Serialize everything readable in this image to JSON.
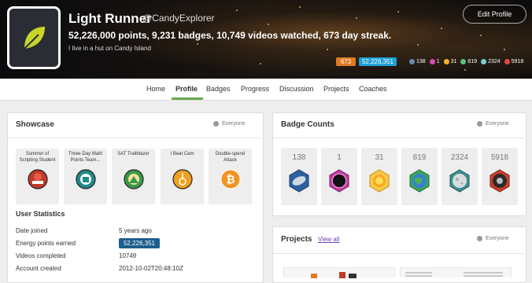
{
  "profile": {
    "name": "Light Runner",
    "handle": "@CandyExplorer",
    "stats_line": "52,226,000 points, 9,231 badges, 10,749 videos watched, 673 day streak.",
    "bio": "I live in a hut on Candy Island",
    "edit_label": "Edit Profile",
    "streak_pill": "673",
    "points_pill": "52,226,351",
    "header_badge_counts": [
      {
        "icon": "meteorite-badge-icon",
        "color": "#6a88b5",
        "value": "138"
      },
      {
        "icon": "moon-badge-icon",
        "color": "#d84bb0",
        "value": "1"
      },
      {
        "icon": "earth-badge-icon",
        "color": "#f0b41e",
        "value": "31"
      },
      {
        "icon": "sun-badge-icon",
        "color": "#5cc07a",
        "value": "819"
      },
      {
        "icon": "black-hole-badge-icon",
        "color": "#7ad0d8",
        "value": "2324"
      },
      {
        "icon": "challenge-patch-icon",
        "color": "#e04a3a",
        "value": "5918"
      }
    ]
  },
  "nav": {
    "items": [
      "Home",
      "Profile",
      "Badges",
      "Progress",
      "Discussion",
      "Projects",
      "Coaches"
    ],
    "active": "Profile"
  },
  "showcase": {
    "title": "Showcase",
    "visibility": "Everyone",
    "badges": [
      {
        "label": "Summer of Scripting Student",
        "icon": "student-patch-icon",
        "color": "#c0392b"
      },
      {
        "label": "Three-Day Math Points Team...",
        "icon": "team-patch-icon",
        "color": "#1f8a8a"
      },
      {
        "label": "SAT Trailblazer",
        "icon": "trailblazer-patch-icon",
        "color": "#3a9a48"
      },
      {
        "label": "I Beat Cam",
        "icon": "unicycle-patch-icon",
        "color": "#f0a020"
      },
      {
        "label": "Double-spend Attack",
        "icon": "bitcoin-patch-icon",
        "color": "#f09422"
      }
    ]
  },
  "user_statistics": {
    "title": "User Statistics",
    "rows": [
      {
        "label": "Date joined",
        "value": "5 years ago"
      },
      {
        "label": "Energy points earned",
        "value": "52,226,351"
      },
      {
        "label": "Videos completed",
        "value": "10749"
      },
      {
        "label": "Account created",
        "value": "2012-10-02T20:48:10Z"
      }
    ]
  },
  "badge_counts": {
    "title": "Badge Counts",
    "visibility": "Everyone",
    "items": [
      {
        "count": "138",
        "icon": "meteorite-badge-icon",
        "color": "#2f5f9e"
      },
      {
        "count": "1",
        "icon": "black-hole-badge-icon",
        "color": "#c03aa0"
      },
      {
        "count": "31",
        "icon": "sun-badge-icon",
        "color": "#f3a81b"
      },
      {
        "count": "819",
        "icon": "earth-badge-icon",
        "color": "#3aa55c"
      },
      {
        "count": "2324",
        "icon": "moon-badge-icon",
        "color": "#3a8f8f"
      },
      {
        "count": "5918",
        "icon": "challenge-patch-icon",
        "color": "#d23c2c"
      }
    ]
  },
  "projects": {
    "title": "Projects",
    "view_all": "View all",
    "visibility": "Everyone"
  }
}
